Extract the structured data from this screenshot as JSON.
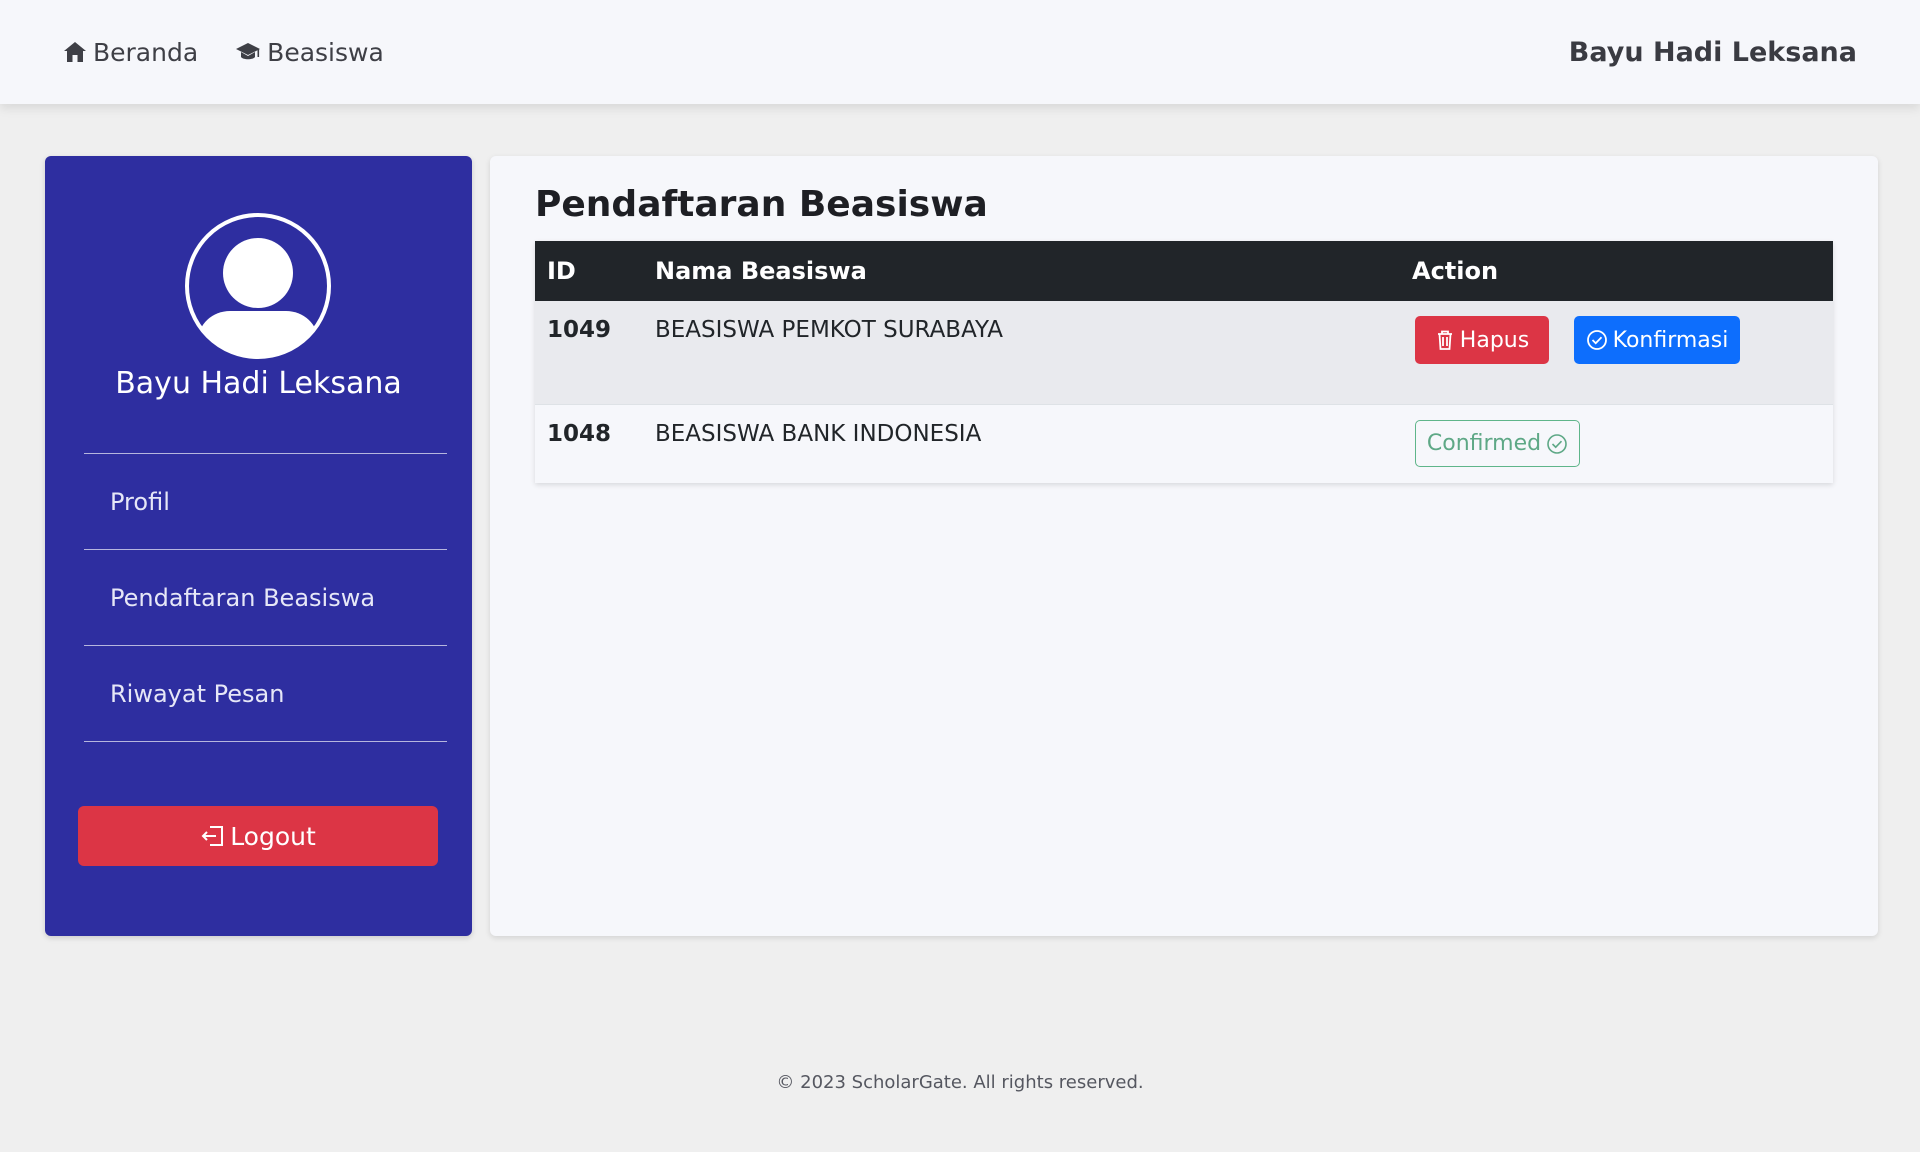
{
  "navbar": {
    "links": [
      {
        "label": "Beranda",
        "icon": "home-icon"
      },
      {
        "label": "Beasiswa",
        "icon": "graduation-cap-icon"
      }
    ],
    "user_name": "Bayu Hadi Leksana"
  },
  "sidebar": {
    "user_name": "Bayu Hadi Leksana",
    "items": [
      {
        "label": "Profil"
      },
      {
        "label": "Pendaftaran Beasiswa"
      },
      {
        "label": "Riwayat Pesan"
      }
    ],
    "logout_label": "Logout"
  },
  "main": {
    "title": "Pendaftaran Beasiswa",
    "table": {
      "headers": {
        "id": "ID",
        "name": "Nama Beasiswa",
        "action": "Action"
      },
      "rows": [
        {
          "id": "1049",
          "name": "BEASISWA PEMKOT SURABAYA",
          "delete_label": "Hapus",
          "confirm_label": "Konfirmasi"
        },
        {
          "id": "1048",
          "name": "BEASISWA BANK INDONESIA",
          "status_label": "Confirmed"
        }
      ]
    }
  },
  "footer": {
    "text": "© 2023 ScholarGate. All rights reserved."
  },
  "colors": {
    "sidebar_bg": "#2e2ea0",
    "danger": "#dc3545",
    "primary": "#0d6efd",
    "success_outline": "#5fb58a",
    "table_header": "#212529"
  }
}
